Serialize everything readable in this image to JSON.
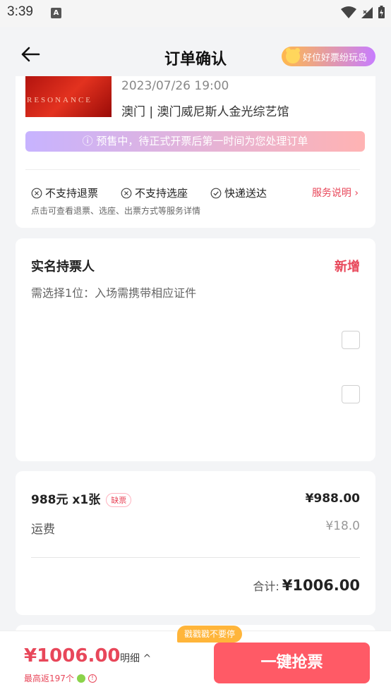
{
  "status": {
    "time": "3:39",
    "a_badge": "A"
  },
  "nav": {
    "title": "订单确认",
    "promo": "好位好票纷玩岛"
  },
  "event": {
    "poster_text": "RESONANCE",
    "datetime": "2023/07/26 19:00",
    "venue": "澳门 | 澳门威尼斯人金光综艺馆",
    "presale_notice": "ⓘ 预售中，待正式开票后第一时间为您处理订单",
    "services": [
      {
        "icon": "x-circle-icon",
        "label": "不支持退票"
      },
      {
        "icon": "x-circle-icon",
        "label": "不支持选座"
      },
      {
        "icon": "check-circle-icon",
        "label": "快递送达"
      }
    ],
    "service_more": "服务说明 ›",
    "service_hint": "点击可查看退票、选座、出票方式等服务详情"
  },
  "holder": {
    "title": "实名持票人",
    "add": "新增",
    "hint": "需选择1位：入场需携带相应证件"
  },
  "price": {
    "item": "988元 x1张",
    "tag": "缺票",
    "item_price": "¥988.00",
    "shipping_label": "运费",
    "shipping_value": "¥18.0",
    "total_label": "合计:",
    "total_value": "¥1006.00"
  },
  "bottom": {
    "price": "¥1006.00",
    "detail": "明细 ^",
    "cashback": "最高返197个",
    "tip": "戳戳戳不要停",
    "buy": "一键抢票"
  },
  "colors": {
    "accent": "#e8475a",
    "button": "#ff5a66",
    "tip": "#ffb53a"
  }
}
